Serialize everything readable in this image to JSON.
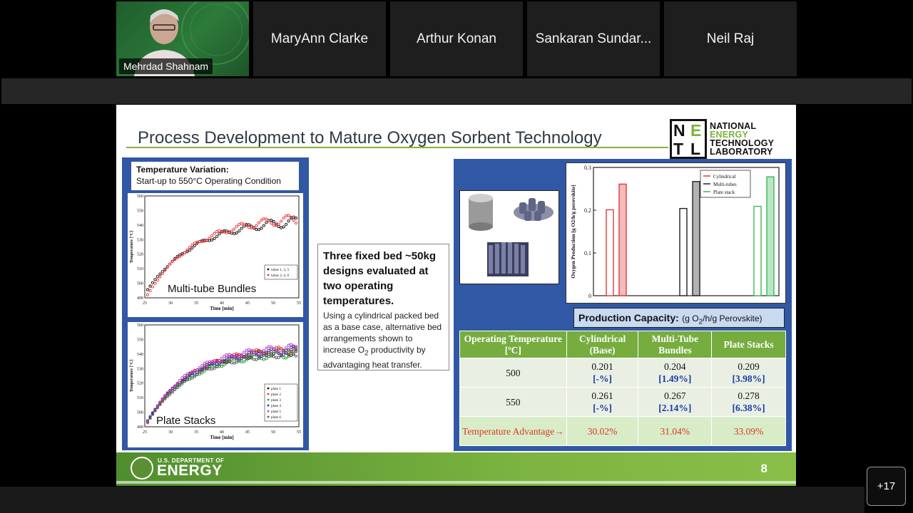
{
  "participants": {
    "active_speaker": "Mehrdad Shahnam",
    "tiles": [
      "MaryAnn Clarke",
      "Arthur Konan",
      "Sankaran Sundar...",
      "Neil Raj"
    ],
    "more_count": "+17"
  },
  "slide": {
    "title": "Process Development to Mature Oxygen Sorbent Technology",
    "logo": {
      "letters": [
        "N",
        "E",
        "T",
        "L"
      ],
      "lines": [
        "NATIONAL",
        "ENERGY",
        "TECHNOLOGY",
        "LABORATORY"
      ]
    },
    "temp_variation": {
      "heading": "Temperature Variation:",
      "subtitle": "Start-up to 550°C Operating Condition"
    },
    "plot1": {
      "label": "Multi-tube Bundles",
      "ylabel": "Temperature [°C]",
      "xlabel": "Time [min]",
      "xticks": [
        "25",
        "30",
        "35",
        "40",
        "45",
        "50",
        "55"
      ],
      "yticks": [
        "490",
        "500",
        "510",
        "520",
        "530",
        "540",
        "550",
        "560"
      ],
      "legend": [
        "tubes 1, 3, 5",
        "tubes 2, 4, 6"
      ]
    },
    "plot2": {
      "label": "Plate Stacks",
      "ylabel": "Temperature [°C]",
      "xlabel": "Time [min]",
      "xticks": [
        "25",
        "30",
        "35",
        "40",
        "45",
        "50",
        "55"
      ],
      "yticks": [
        "490",
        "500",
        "510",
        "520",
        "530",
        "540",
        "550",
        "560"
      ],
      "legend": [
        "plate 1",
        "plate 2",
        "plate 3",
        "plate 4",
        "plate 5",
        "plate 6"
      ]
    },
    "middle": {
      "heading": "Three fixed bed ~50kg designs evaluated at two operating temperatures.",
      "body_pre": "Using a cylindrical packed bed as a base case, alternative bed arrangements shown to increase O",
      "body_sub": "2",
      "body_post": " productivity by advantaging heat transfer."
    },
    "chart_data": {
      "type": "bar",
      "ylabel": "Oxygen Production [g O2/h/g perovskite]",
      "ylim": [
        0,
        0.3
      ],
      "yticks": [
        "0",
        "0.1",
        "0.2",
        "0.3"
      ],
      "legend": [
        "Cylindrical",
        "Multi-tubes",
        "Plate stack"
      ],
      "series": [
        {
          "name": "Cylindrical",
          "color": "#e23a3a",
          "values": [
            0.201,
            0.261
          ]
        },
        {
          "name": "Multi-tubes",
          "color": "#222222",
          "values": [
            0.204,
            0.267
          ]
        },
        {
          "name": "Plate stack",
          "color": "#3cb85a",
          "values": [
            0.209,
            0.278
          ]
        }
      ]
    },
    "capacity": {
      "label": "Production Capacity:",
      "unit_pre": "(g O",
      "unit_sub": "2",
      "unit_post": "/h/g Perovskite)"
    },
    "table": {
      "headers": [
        "Operating Temperature [ºC]",
        "Cylindrical (Base)",
        "Multi-Tube Bundles",
        "Plate Stacks"
      ],
      "rows": [
        {
          "temp": "500",
          "cells": [
            {
              "v": "0.201",
              "p": "[-%]"
            },
            {
              "v": "0.204",
              "p": "[1.49%]"
            },
            {
              "v": "0.209",
              "p": "[3.98%]"
            }
          ]
        },
        {
          "temp": "550",
          "cells": [
            {
              "v": "0.261",
              "p": "[-%]"
            },
            {
              "v": "0.267",
              "p": "[2.14%]"
            },
            {
              "v": "0.278",
              "p": "[6.38%]"
            }
          ]
        }
      ],
      "advantage_label": "Temperature Advantage→",
      "advantage": [
        "30.02%",
        "31.04%",
        "33.09%"
      ]
    },
    "footer": {
      "dept_small": "U.S. DEPARTMENT OF",
      "dept_big": "ENERGY",
      "page": "8"
    }
  }
}
